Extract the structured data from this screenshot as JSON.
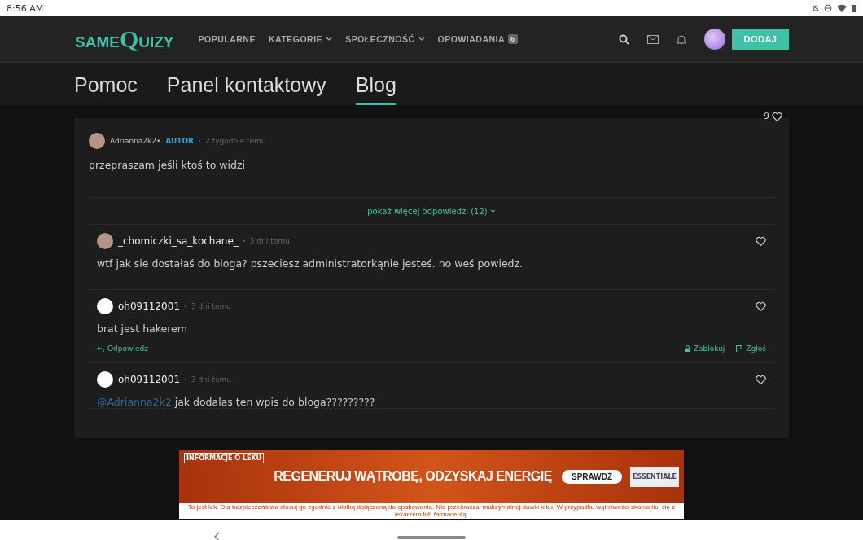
{
  "status_bar": {
    "time": "8:56 AM"
  },
  "nav": {
    "logo": {
      "prefix": "SAME",
      "main": "QUIZY"
    },
    "items": [
      {
        "label": "POPULARNE",
        "dropdown": false
      },
      {
        "label": "KATEGORIE",
        "dropdown": true
      },
      {
        "label": "SPOŁECZNOŚĆ",
        "dropdown": true
      },
      {
        "label": "OPOWIADANIA",
        "dropdown": false,
        "badge": "6"
      }
    ],
    "add_button": "DODAJ"
  },
  "tabs": [
    {
      "label": "Pomoc",
      "selected": false
    },
    {
      "label": "Panel kontaktowy",
      "selected": false
    },
    {
      "label": "Blog",
      "selected": true
    }
  ],
  "post": {
    "likes": "9",
    "author": "Adrianna2k2•",
    "badge": "AUTOR",
    "time": "2 tygodnie temu",
    "text": "przepraszam jeśli ktoś to widzi"
  },
  "more_replies": "pokaż więcej odpowiedzi (12)",
  "replies": [
    {
      "author": "_chomiczki_sa_kochane_",
      "kind": "photo",
      "time": "3 dni temu",
      "text": "wtf jak sie dostałaś do bloga? pszeciesz administratorkąnie jesteś. no weś powiedz."
    },
    {
      "author": "oh09112001",
      "kind": "blank",
      "time": "3 dni temu",
      "text": "brat jest hakerem",
      "actions": {
        "reply": "Odpowiedz",
        "block": "Zablokuj",
        "report": "Zgłoś"
      }
    },
    {
      "author": "oh09112001",
      "kind": "blank",
      "time": "3 dni temu",
      "mention": "@Adrianna2k2",
      "text": "jak dodalas ten wpis do bloga?????????"
    }
  ],
  "ad": {
    "info": "INFORMACJE O LEKU",
    "headline": "REGENERUJ WĄTROBĘ, ODZYSKAJ ENERGIĘ",
    "button": "SPRAWDŹ",
    "product": "ESSENTIALE",
    "disclaimer": "To jest lek. Dla bezpieczeństwa stosuj go zgodnie z ulotką dołączoną do opakowania. Nie przekraczaj maksymalnej dawki leku. W przypadku wątpliwości skonsultuj się z lekarzem lub farmaceutą."
  }
}
